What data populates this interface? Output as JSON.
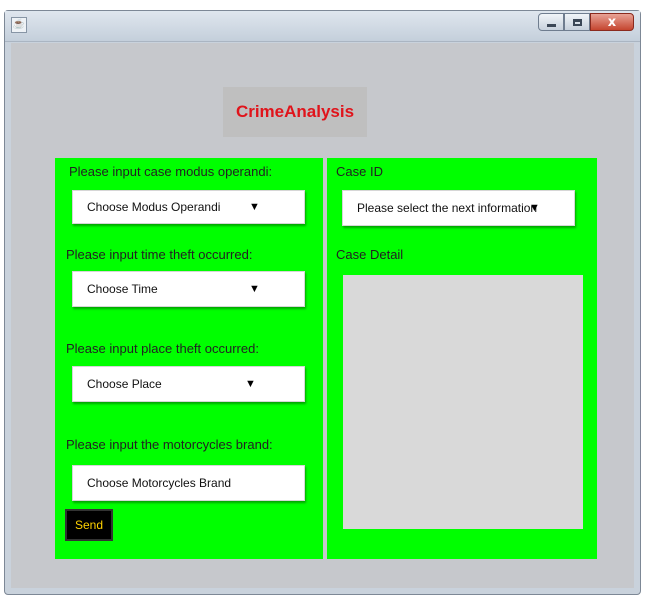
{
  "window": {
    "app_icon": "java-app-icon",
    "controls": [
      "minimize",
      "maximize",
      "close"
    ],
    "close_glyph": "x"
  },
  "header": {
    "title": "CrimeAnalysis"
  },
  "form": {
    "modus_label": "Please input case modus operandi:",
    "modus_select": "Choose Modus Operandi",
    "time_label": "Please input time theft occurred:",
    "time_select": "Choose Time",
    "place_label": "Please input place theft occurred:",
    "place_select": "Choose Place",
    "brand_label": "Please input the motorcycles brand:",
    "brand_select": "Choose Motorcycles Brand",
    "send_label": "Send"
  },
  "case": {
    "id_label": "Case ID",
    "id_select": "Please select the next information",
    "detail_label": "Case Detail",
    "detail_text": ""
  },
  "dropdown_arrow": "▼",
  "colors": {
    "panel": "#00ff00",
    "title": "#e0141b",
    "send_bg": "#000000",
    "send_text": "#ffd200"
  }
}
